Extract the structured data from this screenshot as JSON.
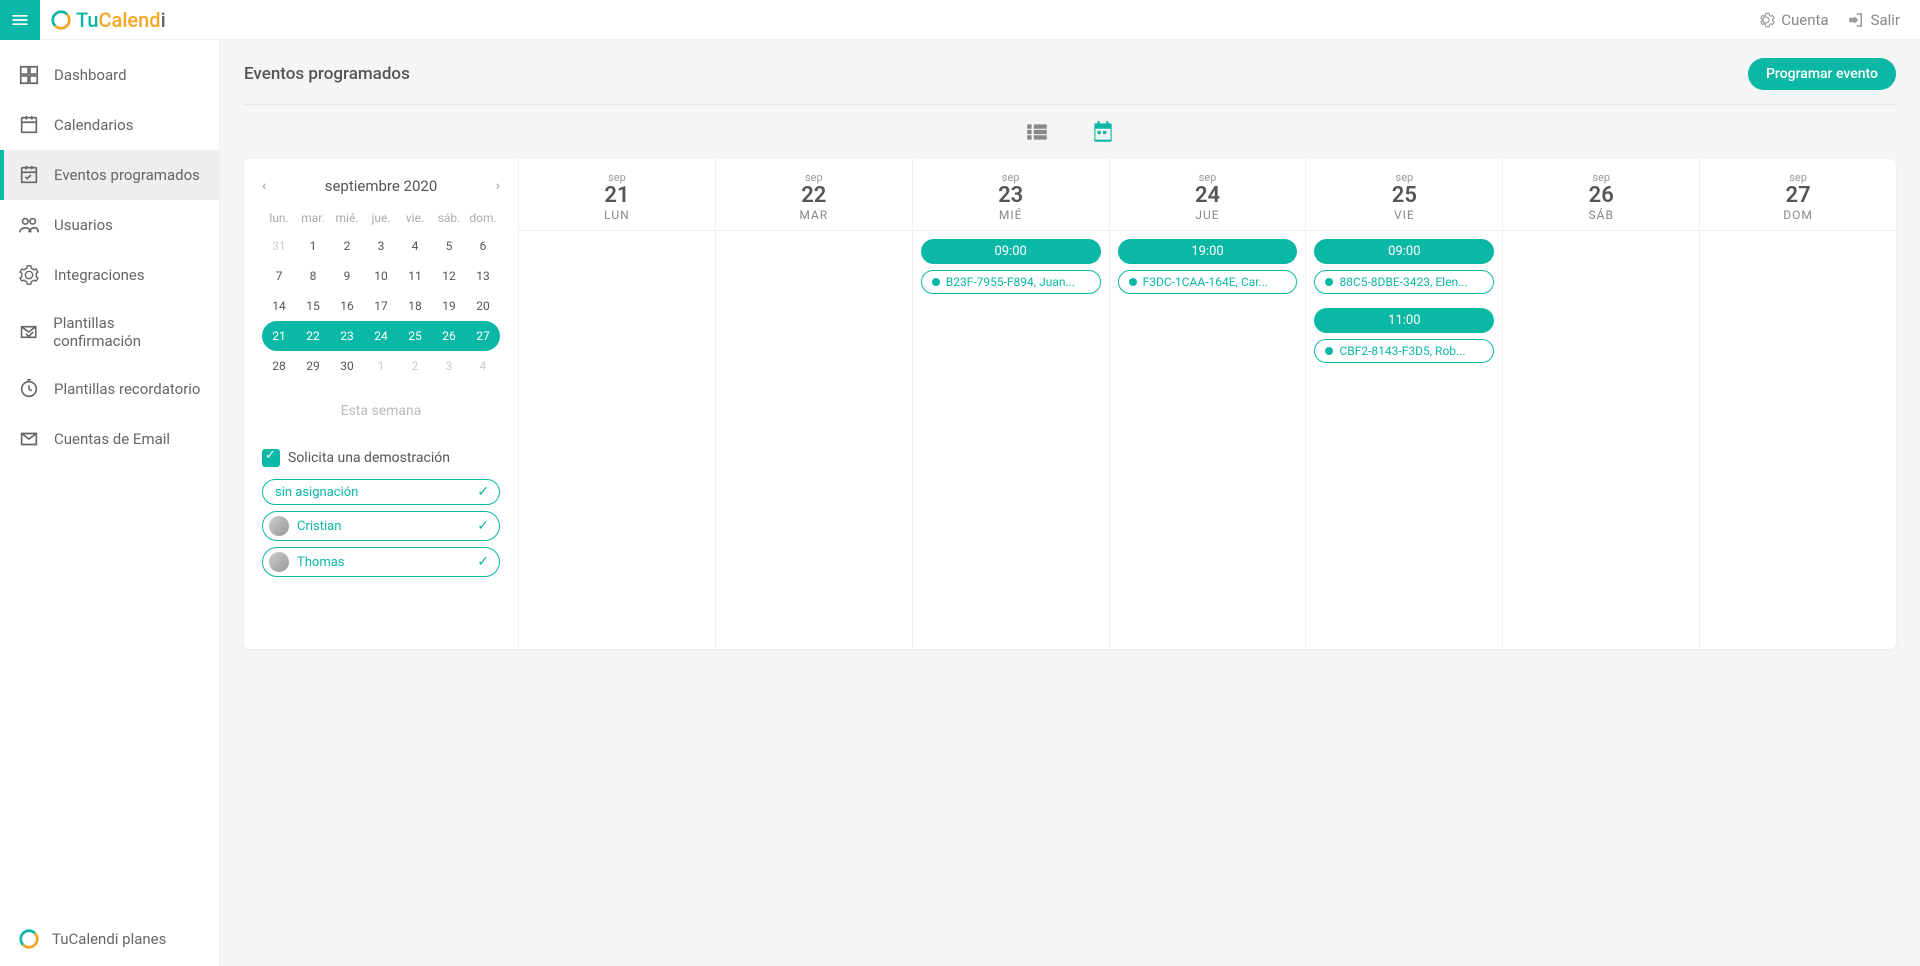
{
  "app": {
    "name": "TuCalendi"
  },
  "topbar": {
    "account": "Cuenta",
    "exit": "Salir"
  },
  "sidebar": {
    "items": [
      {
        "label": "Dashboard"
      },
      {
        "label": "Calendarios"
      },
      {
        "label": "Eventos programados"
      },
      {
        "label": "Usuarios"
      },
      {
        "label": "Integraciones"
      },
      {
        "label": "Plantillas confirmación"
      },
      {
        "label": "Plantillas recordatorio"
      },
      {
        "label": "Cuentas de Email"
      }
    ],
    "footer": "TuCalendi planes"
  },
  "page": {
    "title": "Eventos programados",
    "cta": "Programar evento"
  },
  "minical": {
    "title": "septiembre 2020",
    "this_week": "Esta semana",
    "dow": [
      "lun.",
      "mar.",
      "mié.",
      "jue.",
      "vie.",
      "sáb.",
      "dom."
    ],
    "weeks": [
      {
        "sel": false,
        "days": [
          {
            "n": "31",
            "m": true
          },
          {
            "n": "1"
          },
          {
            "n": "2"
          },
          {
            "n": "3"
          },
          {
            "n": "4"
          },
          {
            "n": "5"
          },
          {
            "n": "6"
          }
        ]
      },
      {
        "sel": false,
        "days": [
          {
            "n": "7"
          },
          {
            "n": "8"
          },
          {
            "n": "9"
          },
          {
            "n": "10"
          },
          {
            "n": "11"
          },
          {
            "n": "12"
          },
          {
            "n": "13"
          }
        ]
      },
      {
        "sel": false,
        "days": [
          {
            "n": "14"
          },
          {
            "n": "15"
          },
          {
            "n": "16"
          },
          {
            "n": "17"
          },
          {
            "n": "18"
          },
          {
            "n": "19"
          },
          {
            "n": "20"
          }
        ]
      },
      {
        "sel": true,
        "days": [
          {
            "n": "21"
          },
          {
            "n": "22"
          },
          {
            "n": "23"
          },
          {
            "n": "24"
          },
          {
            "n": "25"
          },
          {
            "n": "26"
          },
          {
            "n": "27"
          }
        ]
      },
      {
        "sel": false,
        "days": [
          {
            "n": "28"
          },
          {
            "n": "29"
          },
          {
            "n": "30"
          },
          {
            "n": "1",
            "m": true
          },
          {
            "n": "2",
            "m": true
          },
          {
            "n": "3",
            "m": true
          },
          {
            "n": "4",
            "m": true
          }
        ]
      }
    ]
  },
  "filter": {
    "event_type": "Solicita una demostración",
    "assignees": [
      {
        "label": "sin asignación",
        "avatar": false
      },
      {
        "label": "Cristian",
        "avatar": true
      },
      {
        "label": "Thomas",
        "avatar": true
      }
    ]
  },
  "week": {
    "month_short": "sep",
    "days": [
      {
        "num": "21",
        "dow": "LUN",
        "events": []
      },
      {
        "num": "22",
        "dow": "MAR",
        "events": []
      },
      {
        "num": "23",
        "dow": "MIÉ",
        "events": [
          {
            "time": "09:00",
            "title": "B23F-7955-F894, Juan..."
          }
        ]
      },
      {
        "num": "24",
        "dow": "JUE",
        "events": [
          {
            "time": "19:00",
            "title": "F3DC-1CAA-164E, Car..."
          }
        ]
      },
      {
        "num": "25",
        "dow": "VIE",
        "events": [
          {
            "time": "09:00",
            "title": "88C5-8DBE-3423, Elen..."
          },
          {
            "time": "11:00",
            "title": "CBF2-8143-F3D5, Rob..."
          }
        ]
      },
      {
        "num": "26",
        "dow": "SÁB",
        "events": []
      },
      {
        "num": "27",
        "dow": "DOM",
        "events": []
      }
    ]
  }
}
